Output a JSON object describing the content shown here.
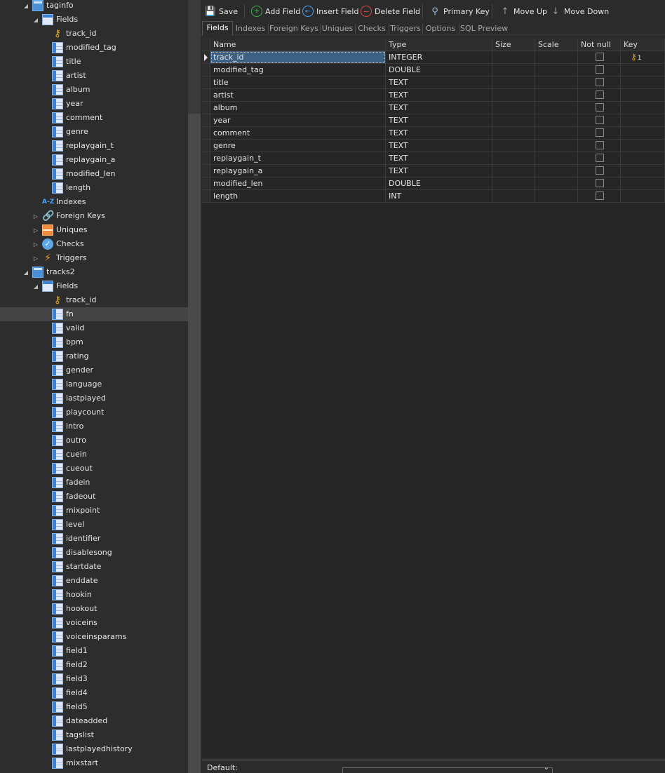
{
  "tree": {
    "nodes": [
      {
        "label": "taginfo",
        "icon": "table",
        "level": 1,
        "expander": "open"
      },
      {
        "label": "Fields",
        "icon": "folder",
        "level": 2,
        "expander": "open"
      },
      {
        "label": "track_id",
        "icon": "key",
        "level": 3
      },
      {
        "label": "modified_tag",
        "icon": "field",
        "level": 3
      },
      {
        "label": "title",
        "icon": "field",
        "level": 3
      },
      {
        "label": "artist",
        "icon": "field",
        "level": 3
      },
      {
        "label": "album",
        "icon": "field",
        "level": 3
      },
      {
        "label": "year",
        "icon": "field",
        "level": 3
      },
      {
        "label": "comment",
        "icon": "field",
        "level": 3
      },
      {
        "label": "genre",
        "icon": "field",
        "level": 3
      },
      {
        "label": "replaygain_t",
        "icon": "field",
        "level": 3
      },
      {
        "label": "replaygain_a",
        "icon": "field",
        "level": 3
      },
      {
        "label": "modified_len",
        "icon": "field",
        "level": 3
      },
      {
        "label": "length",
        "icon": "field",
        "level": 3
      },
      {
        "label": "Indexes",
        "icon": "az",
        "level": 2
      },
      {
        "label": "Foreign Keys",
        "icon": "link",
        "level": 2,
        "expander": "closed"
      },
      {
        "label": "Uniques",
        "icon": "uniques",
        "level": 2,
        "expander": "closed"
      },
      {
        "label": "Checks",
        "icon": "checks",
        "level": 2,
        "expander": "closed"
      },
      {
        "label": "Triggers",
        "icon": "trigger",
        "level": 2,
        "expander": "closed"
      },
      {
        "label": "tracks2",
        "icon": "table",
        "level": 1,
        "expander": "open"
      },
      {
        "label": "Fields",
        "icon": "folder",
        "level": 2,
        "expander": "open"
      },
      {
        "label": "track_id",
        "icon": "key",
        "level": 3
      },
      {
        "label": "fn",
        "icon": "field",
        "level": 3,
        "selected": true
      },
      {
        "label": "valid",
        "icon": "field",
        "level": 3
      },
      {
        "label": "bpm",
        "icon": "field",
        "level": 3
      },
      {
        "label": "rating",
        "icon": "field",
        "level": 3
      },
      {
        "label": "gender",
        "icon": "field",
        "level": 3
      },
      {
        "label": "language",
        "icon": "field",
        "level": 3
      },
      {
        "label": "lastplayed",
        "icon": "field",
        "level": 3
      },
      {
        "label": "playcount",
        "icon": "field",
        "level": 3
      },
      {
        "label": "intro",
        "icon": "field",
        "level": 3
      },
      {
        "label": "outro",
        "icon": "field",
        "level": 3
      },
      {
        "label": "cuein",
        "icon": "field",
        "level": 3
      },
      {
        "label": "cueout",
        "icon": "field",
        "level": 3
      },
      {
        "label": "fadein",
        "icon": "field",
        "level": 3
      },
      {
        "label": "fadeout",
        "icon": "field",
        "level": 3
      },
      {
        "label": "mixpoint",
        "icon": "field",
        "level": 3
      },
      {
        "label": "level",
        "icon": "field",
        "level": 3
      },
      {
        "label": "identifier",
        "icon": "field",
        "level": 3
      },
      {
        "label": "disablesong",
        "icon": "field",
        "level": 3
      },
      {
        "label": "startdate",
        "icon": "field",
        "level": 3
      },
      {
        "label": "enddate",
        "icon": "field",
        "level": 3
      },
      {
        "label": "hookin",
        "icon": "field",
        "level": 3
      },
      {
        "label": "hookout",
        "icon": "field",
        "level": 3
      },
      {
        "label": "voiceins",
        "icon": "field",
        "level": 3
      },
      {
        "label": "voiceinsparams",
        "icon": "field",
        "level": 3
      },
      {
        "label": "field1",
        "icon": "field",
        "level": 3
      },
      {
        "label": "field2",
        "icon": "field",
        "level": 3
      },
      {
        "label": "field3",
        "icon": "field",
        "level": 3
      },
      {
        "label": "field4",
        "icon": "field",
        "level": 3
      },
      {
        "label": "field5",
        "icon": "field",
        "level": 3
      },
      {
        "label": "dateadded",
        "icon": "field",
        "level": 3
      },
      {
        "label": "tagslist",
        "icon": "field",
        "level": 3
      },
      {
        "label": "lastplayedhistory",
        "icon": "field",
        "level": 3
      },
      {
        "label": "mixstart",
        "icon": "field",
        "level": 3
      }
    ]
  },
  "toolbar": {
    "save": "Save",
    "add_field": "Add Field",
    "insert_field": "Insert Field",
    "delete_field": "Delete Field",
    "primary_key": "Primary Key",
    "move_up": "Move Up",
    "move_down": "Move Down"
  },
  "tabs": [
    "Fields",
    "Indexes",
    "Foreign Keys",
    "Uniques",
    "Checks",
    "Triggers",
    "Options",
    "SQL Preview"
  ],
  "grid": {
    "columns": [
      "Name",
      "Type",
      "Size",
      "Scale",
      "Not null",
      "Key"
    ],
    "rows": [
      {
        "name": "track_id",
        "type": "INTEGER",
        "size": "",
        "scale": "",
        "not_null": false,
        "key": "1"
      },
      {
        "name": "modified_tag",
        "type": "DOUBLE",
        "size": "",
        "scale": "",
        "not_null": false,
        "key": ""
      },
      {
        "name": "title",
        "type": "TEXT",
        "size": "",
        "scale": "",
        "not_null": false,
        "key": ""
      },
      {
        "name": "artist",
        "type": "TEXT",
        "size": "",
        "scale": "",
        "not_null": false,
        "key": ""
      },
      {
        "name": "album",
        "type": "TEXT",
        "size": "",
        "scale": "",
        "not_null": false,
        "key": ""
      },
      {
        "name": "year",
        "type": "TEXT",
        "size": "",
        "scale": "",
        "not_null": false,
        "key": ""
      },
      {
        "name": "comment",
        "type": "TEXT",
        "size": "",
        "scale": "",
        "not_null": false,
        "key": ""
      },
      {
        "name": "genre",
        "type": "TEXT",
        "size": "",
        "scale": "",
        "not_null": false,
        "key": ""
      },
      {
        "name": "replaygain_t",
        "type": "TEXT",
        "size": "",
        "scale": "",
        "not_null": false,
        "key": ""
      },
      {
        "name": "replaygain_a",
        "type": "TEXT",
        "size": "",
        "scale": "",
        "not_null": false,
        "key": ""
      },
      {
        "name": "modified_len",
        "type": "DOUBLE",
        "size": "",
        "scale": "",
        "not_null": false,
        "key": ""
      },
      {
        "name": "length",
        "type": "INT",
        "size": "",
        "scale": "",
        "not_null": false,
        "key": ""
      }
    ]
  },
  "bottom": {
    "default_label": "Default:"
  },
  "colors": {
    "background": "#2b2b2b",
    "selection": "#3d6185",
    "key_gold": "#e8a817"
  }
}
